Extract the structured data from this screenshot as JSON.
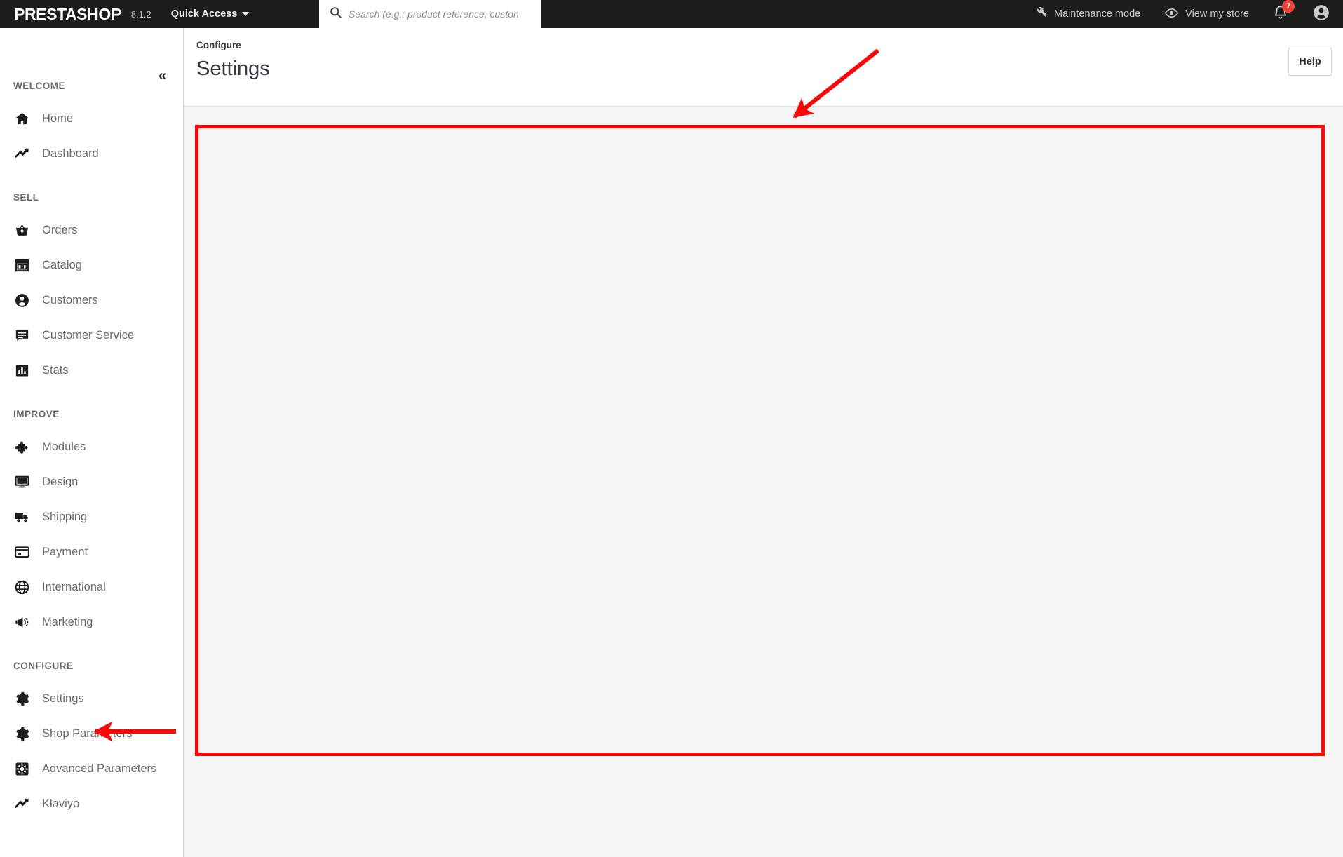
{
  "topbar": {
    "brand": "PRESTASHOP",
    "version": "8.1.2",
    "quick_access": "Quick Access",
    "search_placeholder": "Search (e.g.: product reference, custon",
    "search_value": "",
    "maintenance_mode": "Maintenance mode",
    "view_my_store": "View my store",
    "notification_count": "7",
    "icons": {
      "search": "search-icon",
      "wrench": "wrench-icon",
      "eye": "eye-icon",
      "bell": "bell-icon",
      "avatar": "account-avatar-icon"
    }
  },
  "sidebar": {
    "collapse_glyph": "«",
    "sections": [
      {
        "title": "WELCOME",
        "items": [
          {
            "label": "Home",
            "icon": "home-icon"
          },
          {
            "label": "Dashboard",
            "icon": "trending-up-icon"
          }
        ]
      },
      {
        "title": "SELL",
        "items": [
          {
            "label": "Orders",
            "icon": "shopping-basket-icon"
          },
          {
            "label": "Catalog",
            "icon": "store-icon"
          },
          {
            "label": "Customers",
            "icon": "person-circle-icon"
          },
          {
            "label": "Customer Service",
            "icon": "chat-bubble-icon"
          },
          {
            "label": "Stats",
            "icon": "bar-chart-icon"
          }
        ]
      },
      {
        "title": "IMPROVE",
        "items": [
          {
            "label": "Modules",
            "icon": "puzzle-piece-icon"
          },
          {
            "label": "Design",
            "icon": "monitor-icon"
          },
          {
            "label": "Shipping",
            "icon": "truck-icon"
          },
          {
            "label": "Payment",
            "icon": "credit-card-icon"
          },
          {
            "label": "International",
            "icon": "globe-icon"
          },
          {
            "label": "Marketing",
            "icon": "megaphone-icon"
          }
        ]
      },
      {
        "title": "CONFIGURE",
        "items": [
          {
            "label": "Settings",
            "icon": "gear-icon"
          },
          {
            "label": "Shop Parameters",
            "icon": "gear-icon"
          },
          {
            "label": "Advanced Parameters",
            "icon": "settings-square-icon"
          },
          {
            "label": "Klaviyo",
            "icon": "trending-up-icon"
          }
        ]
      }
    ]
  },
  "page": {
    "breadcrumb": "Configure",
    "title": "Settings",
    "help_label": "Help"
  },
  "annotations": {
    "color": "#fb0707",
    "arrow_to_content": "arrow pointing to content panel",
    "arrow_to_settings": "arrow pointing to Settings sidebar item"
  }
}
